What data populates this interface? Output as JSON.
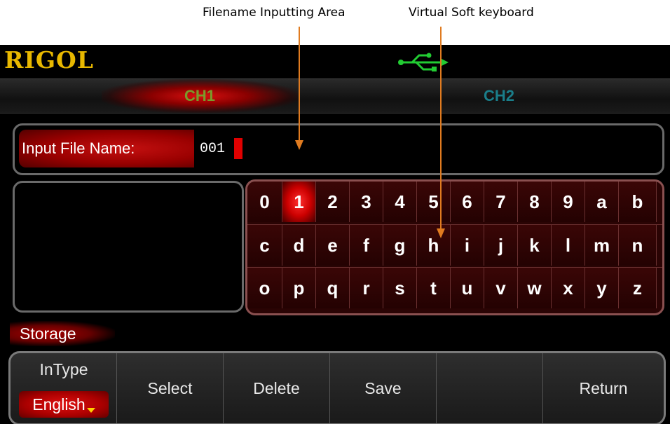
{
  "annotations": {
    "filename_area": "Filename Inputting Area",
    "soft_keyboard": "Virtual Soft keyboard"
  },
  "header": {
    "logo": "RIGOL",
    "usb_icon": "usb-icon"
  },
  "channels": {
    "ch1": "CH1",
    "ch2": "CH2",
    "active": "CH1"
  },
  "file_input": {
    "label": "Input File Name:",
    "value": "001"
  },
  "keyboard": {
    "rows": [
      [
        "0",
        "1",
        "2",
        "3",
        "4",
        "5",
        "6",
        "7",
        "8",
        "9",
        "a",
        "b"
      ],
      [
        "c",
        "d",
        "e",
        "f",
        "g",
        "h",
        "i",
        "j",
        "k",
        "l",
        "m",
        "n"
      ],
      [
        "o",
        "p",
        "q",
        "r",
        "s",
        "t",
        "u",
        "v",
        "w",
        "x",
        "y",
        "z"
      ]
    ],
    "selected": "1"
  },
  "menu": {
    "title": "Storage",
    "intype_label": "InType",
    "intype_value": "English",
    "select": "Select",
    "delete": "Delete",
    "save": "Save",
    "empty": "",
    "return": "Return"
  },
  "colors": {
    "logo": "#e8b800",
    "ch1": "#7a9a2a",
    "ch2": "#1a7e8a",
    "highlight": "#c00000",
    "annotation_arrow": "#e07b20"
  }
}
